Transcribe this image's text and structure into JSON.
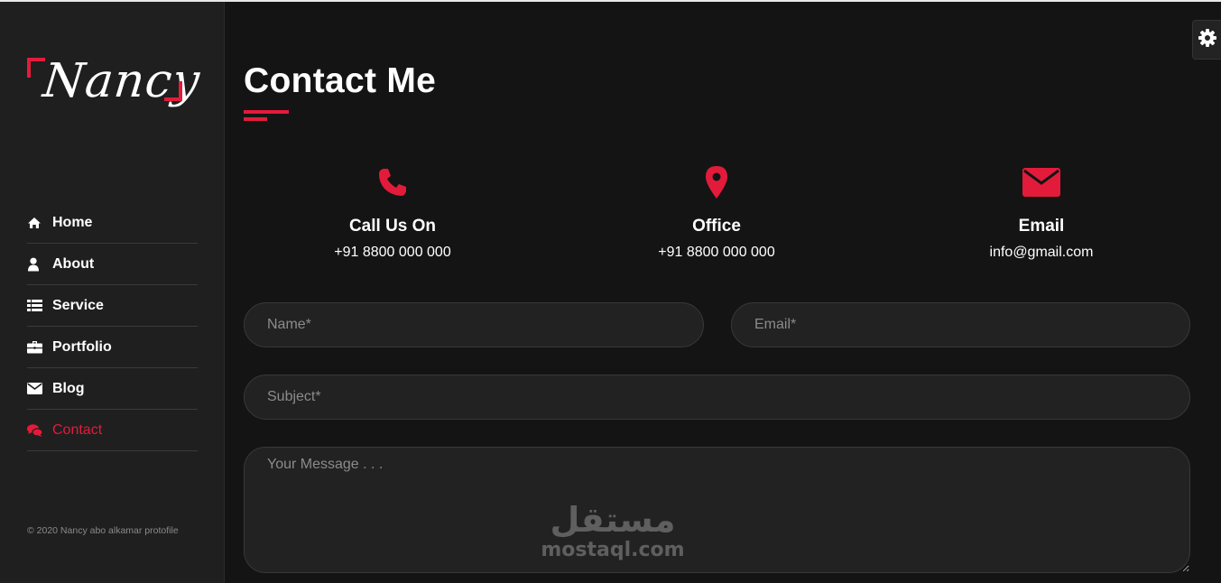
{
  "brand": {
    "logo_text": "Nancy",
    "accent": "#e31b3b"
  },
  "sidebar": {
    "items": [
      {
        "label": "Home",
        "icon": "home-icon"
      },
      {
        "label": "About",
        "icon": "user-icon"
      },
      {
        "label": "Service",
        "icon": "list-icon"
      },
      {
        "label": "Portfolio",
        "icon": "briefcase-icon"
      },
      {
        "label": "Blog",
        "icon": "envelope-icon"
      },
      {
        "label": "Contact",
        "icon": "comments-icon",
        "active": true
      }
    ],
    "copyright": "© 2020 Nancy abo alkamar protofile"
  },
  "main": {
    "title": "Contact Me",
    "info": [
      {
        "icon": "phone-icon",
        "title": "Call Us On",
        "value": "+91 8800 000 000"
      },
      {
        "icon": "map-marker-icon",
        "title": "Office",
        "value": "+91 8800 000 000"
      },
      {
        "icon": "envelope-icon",
        "title": "Email",
        "value": "info@gmail.com"
      }
    ],
    "form": {
      "name_placeholder": "Name*",
      "email_placeholder": "Email*",
      "subject_placeholder": "Subject*",
      "message_placeholder": "Your Message . . ."
    }
  },
  "settings": {
    "icon": "gear-icon"
  },
  "watermark": {
    "arabic": "مستقل",
    "latin": "mostaql.com"
  }
}
